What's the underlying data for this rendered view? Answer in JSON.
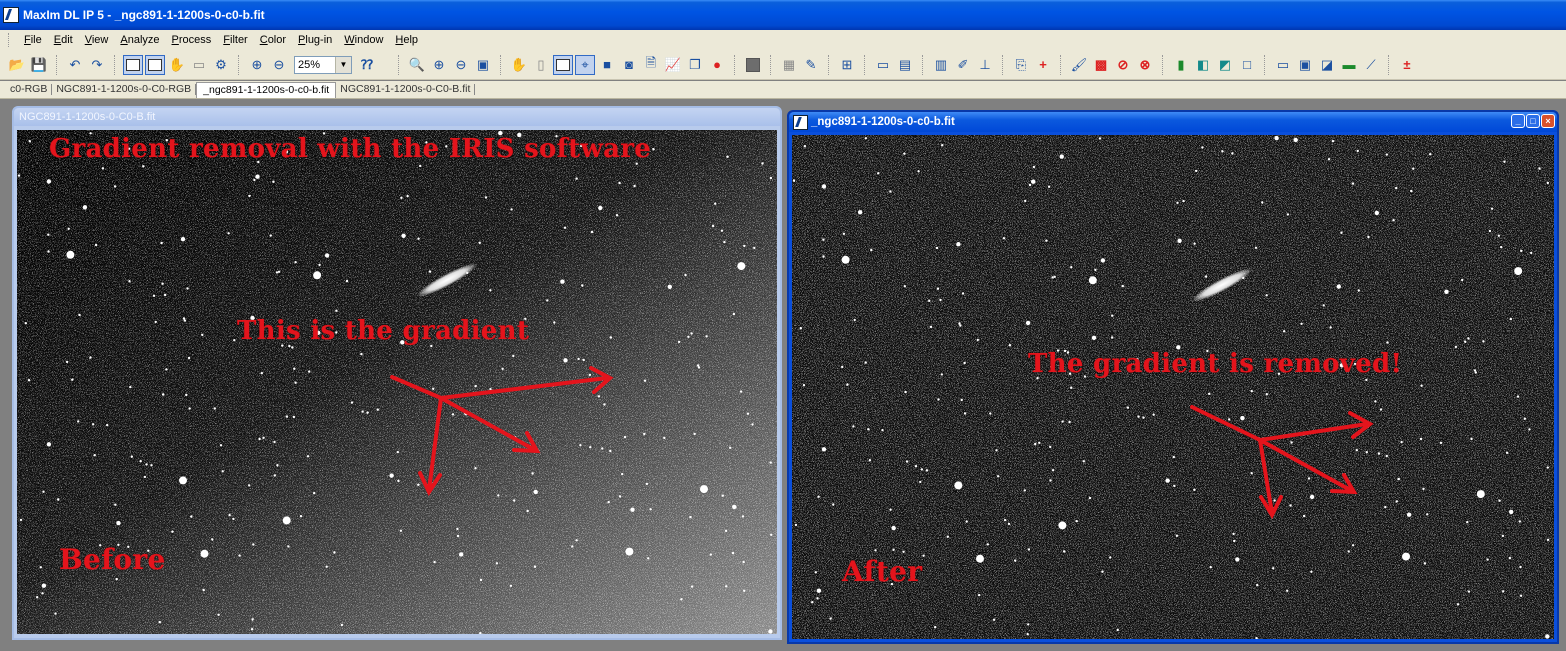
{
  "app": {
    "title": "MaxIm DL IP 5 - _ngc891-1-1200s-0-c0-b.fit"
  },
  "menu": [
    {
      "key": "F",
      "rest": "ile"
    },
    {
      "key": "E",
      "rest": "dit"
    },
    {
      "key": "V",
      "rest": "iew"
    },
    {
      "key": "A",
      "rest": "nalyze"
    },
    {
      "key": "P",
      "rest": "rocess"
    },
    {
      "key": "F",
      "rest": "ilter"
    },
    {
      "key": "C",
      "rest": "olor"
    },
    {
      "key": "P",
      "rest": "lug-in"
    },
    {
      "key": "W",
      "rest": "indow"
    },
    {
      "key": "H",
      "rest": "elp"
    }
  ],
  "toolbar": {
    "zoom_value": "25%",
    "icons": [
      "open-icon",
      "save-icon",
      "undo-icon",
      "redo-icon",
      "screen-stretch-icon",
      "full-stretch-icon",
      "hand-icon",
      "bucket-icon",
      "settings-icon",
      "zoom-in-icon",
      "zoom-out-icon",
      "help-icon",
      "find-icon",
      "zoom-in-plus-icon",
      "zoom-out-minus-icon",
      "fit-icon",
      "pointer-icon",
      "eraser-icon",
      "image-stretch-icon",
      "crosshair-icon",
      "square-icon",
      "filter-icon",
      "info-icon",
      "graph-icon",
      "layers-icon",
      "color-icon",
      "gray-square-icon",
      "grid-icon",
      "annotate-icon",
      "layout-icon",
      "ruler-icon",
      "calc-icon",
      "document-icon",
      "edit-icon",
      "measure-icon",
      "copy-icon",
      "add-icon",
      "brush-icon",
      "array-icon",
      "stop-icon",
      "no-icon",
      "histogram-icon",
      "blink-icon",
      "align-icon",
      "crop-icon",
      "frame-icon",
      "image-icon",
      "compare-icon",
      "slider-icon",
      "curve-icon",
      "plus-minus-icon"
    ]
  },
  "tabs": [
    {
      "label": "c0-RGB",
      "active": false
    },
    {
      "label": "NGC891-1-1200s-0-C0-RGB",
      "active": false
    },
    {
      "label": "_ngc891-1-1200s-0-c0-b.fit",
      "active": true
    },
    {
      "label": "NGC891-1-1200s-0-C0-B.fit",
      "active": false
    }
  ],
  "left_window": {
    "title": "NGC891-1-1200s-0-C0-B.fit",
    "annotations": {
      "headline": "Gradient removal with the IRIS software",
      "gradient_note": "This is the gradient",
      "before_label": "Before"
    }
  },
  "right_window": {
    "title": "_ngc891-1-1200s-0-c0-b.fit",
    "buttons": {
      "minimize": "_",
      "restore": "□",
      "close": "×"
    },
    "annotations": {
      "removed_note": "The gradient is removed!",
      "after_label": "After"
    }
  },
  "colors": {
    "annotation_red": "#e4141c",
    "xp_blue": "#0054e3",
    "toolbar_bg": "#ece9d8",
    "mdi_bg": "#808080"
  }
}
